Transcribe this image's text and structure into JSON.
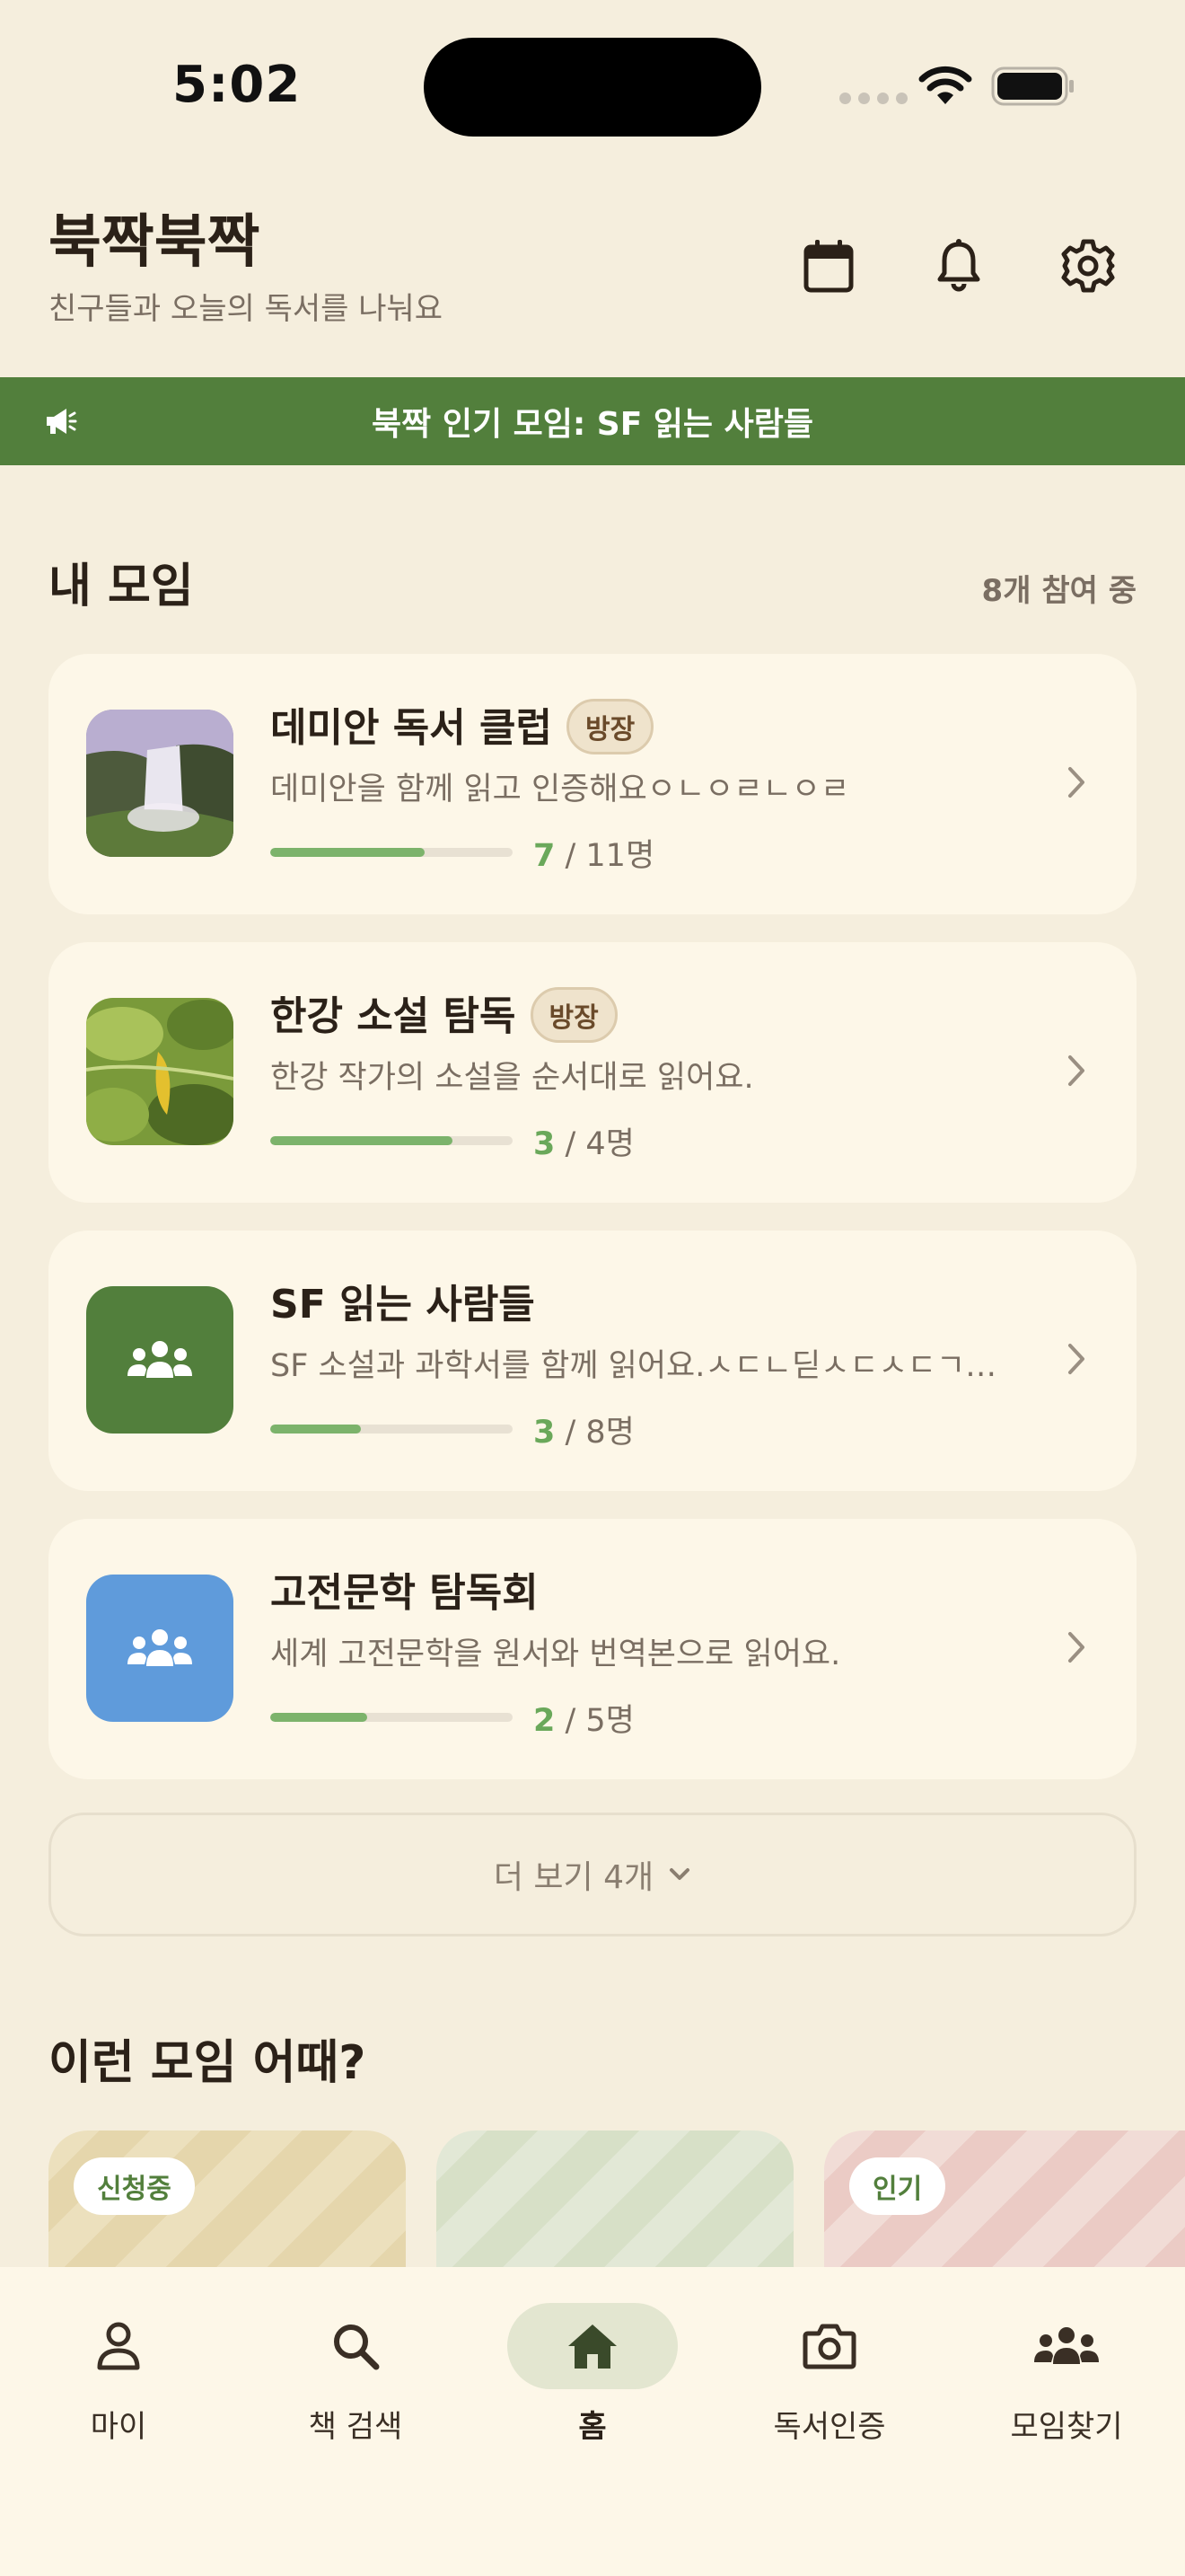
{
  "status_bar": {
    "time": "5:02"
  },
  "header": {
    "title": "북짝북짝",
    "subtitle": "친구들과 오늘의 독서를 나눠요",
    "icons": [
      "calendar-icon",
      "bell-icon",
      "gear-icon"
    ]
  },
  "banner": {
    "text": "북짝 인기 모임: SF 읽는 사람들",
    "icon": "megaphone-icon"
  },
  "my_groups": {
    "title": "내 모임",
    "count_label": "8개 참여 중",
    "items": [
      {
        "name": "데미안 독서 클럽",
        "badge": "방장",
        "description": "데미안을 함께 읽고 인증해요ㅇㄴㅇㄹㄴㅇㄹ",
        "current": "7",
        "rest": " / 11명",
        "progress": 0.636,
        "thumb": "waterfall-photo"
      },
      {
        "name": "한강 소설 탐독",
        "badge": "방장",
        "description": "한강 작가의 소설을 순서대로 읽어요.",
        "current": "3",
        "rest": " / 4명",
        "progress": 0.75,
        "thumb": "leaf-photo"
      },
      {
        "name": "SF 읽는 사람들",
        "badge": "",
        "description": "SF 소설과 과학서를 함께 읽어요.ㅅㄷㄴ딛ㅅㄷㅅㄷㄱ…",
        "current": "3",
        "rest": " / 8명",
        "progress": 0.375,
        "thumb": "group-icon",
        "thumb_color": "#527f3c"
      },
      {
        "name": "고전문학 탐독회",
        "badge": "",
        "description": "세계 고전문학을 원서와 번역본으로 읽어요.",
        "current": "2",
        "rest": " / 5명",
        "progress": 0.4,
        "thumb": "group-icon",
        "thumb_color": "#5f9bdb"
      }
    ],
    "more_label": "더 보기 4개"
  },
  "recommend": {
    "title": "이런 모임 어때?",
    "cards": [
      {
        "badge": "신청중",
        "color": "#efe3c0",
        "badge_color": "#527f3c"
      },
      {
        "badge": "",
        "color": "#e4e9d8",
        "badge_color": "#527f3c"
      },
      {
        "badge": "인기",
        "color": "#f2dcd8",
        "badge_color": "#527f3c"
      }
    ]
  },
  "tab_bar": {
    "tabs": [
      {
        "label": "마이",
        "icon": "person-icon",
        "active": false
      },
      {
        "label": "책 검색",
        "icon": "search-icon",
        "active": false
      },
      {
        "label": "홈",
        "icon": "home-icon",
        "active": true
      },
      {
        "label": "독서인증",
        "icon": "camera-icon",
        "active": false
      },
      {
        "label": "모임찾기",
        "icon": "group-icon",
        "active": false
      }
    ]
  },
  "colors": {
    "primary": "#527f3c",
    "background": "#f5eedd",
    "card": "#fdf7e8",
    "progress": "#7cb36b"
  }
}
